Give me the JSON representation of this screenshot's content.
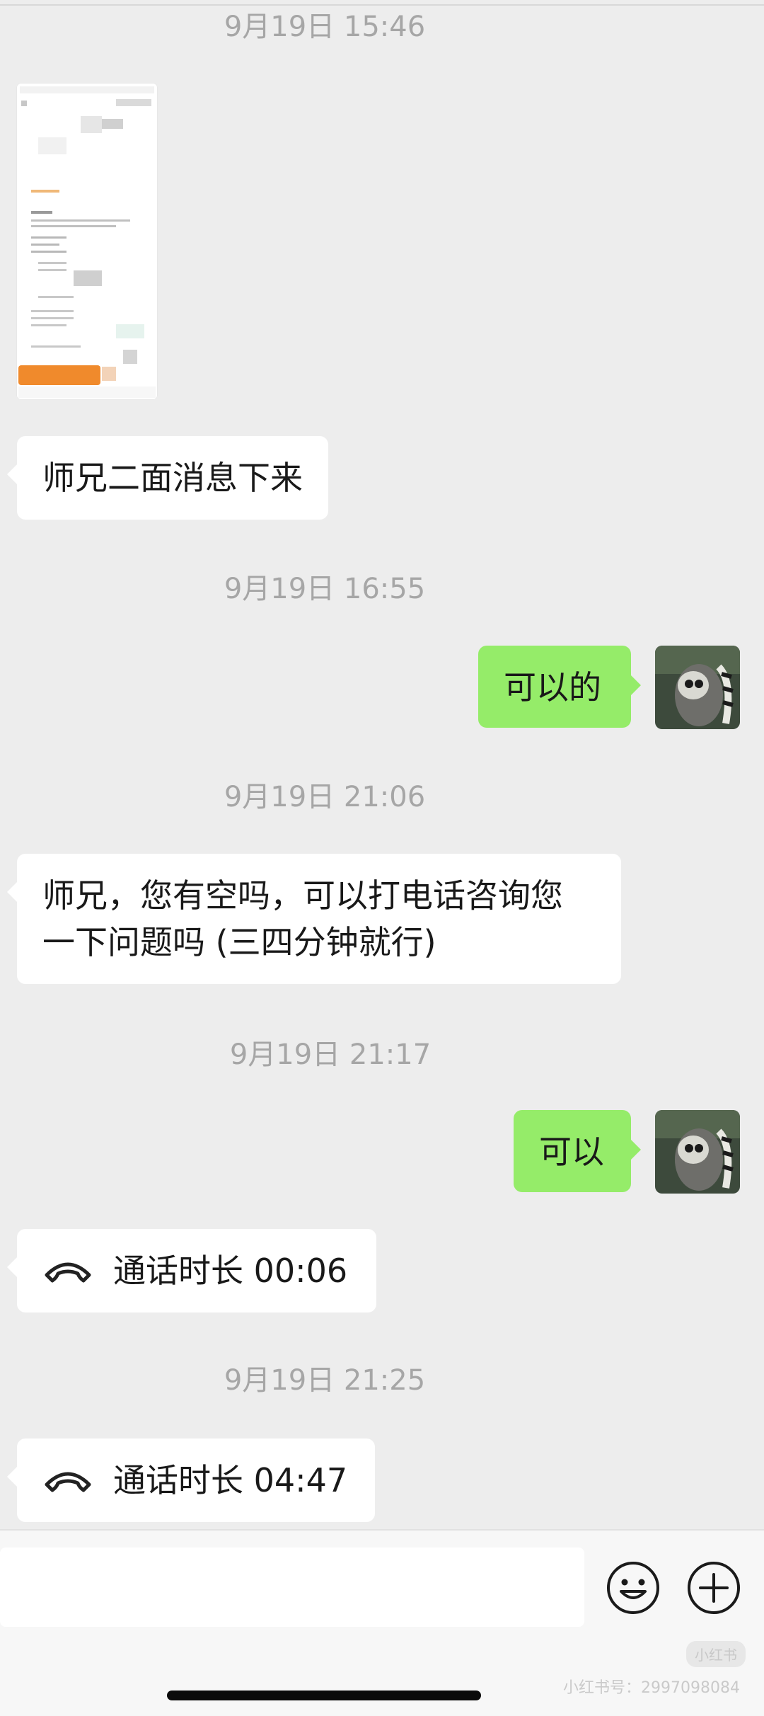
{
  "messages": {
    "ts1": "9月19日 15:46",
    "msg1": "师兄二面消息下来",
    "ts2": "9月19日 16:55",
    "msg2": "可以的",
    "ts3": "9月19日 21:06",
    "msg3_line1": "师兄，您有空吗，可以打电话咨询您",
    "msg3_line2": "一下问题吗 (三四分钟就行)",
    "ts4": "9月19日 21:17",
    "msg4": "可以",
    "call1": "通话时长 00:06",
    "ts5": "9月19日 21:25",
    "call2": "通话时长 04:47"
  },
  "input_bar": {
    "emoji_icon": "smile-icon",
    "plus_icon": "plus-icon"
  },
  "watermark": {
    "badge": "小红书",
    "text": "小红书号：2997098084"
  },
  "colors": {
    "background": "#ededed",
    "incoming_bubble": "#ffffff",
    "outgoing_bubble": "#95ec69",
    "timestamp": "#a6a6a6"
  }
}
